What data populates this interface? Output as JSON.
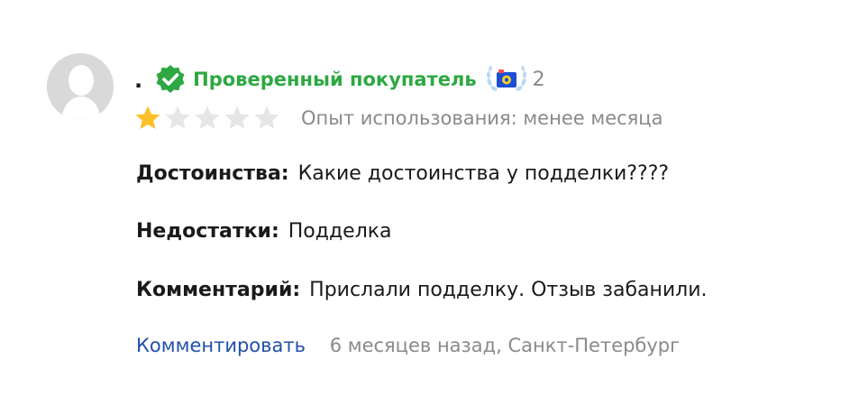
{
  "review": {
    "author_name": ".",
    "verified_label": "Проверенный покупатель",
    "award_count": "2",
    "rating": 1,
    "rating_max": 5,
    "usage_text": "Опыт использования: менее месяца",
    "pros_label": "Достоинства:",
    "pros_text": "Какие достоинства у подделки????",
    "cons_label": "Недостатки:",
    "cons_text": "Подделка",
    "comment_label": "Комментарий:",
    "comment_text": "Прислали подделку. Отзыв забанили.",
    "reply_link": "Комментировать",
    "meta": "6 месяцев назад, Санкт-Петербург"
  },
  "colors": {
    "verified_green": "#2ea842",
    "star_filled": "#fcc02b",
    "star_empty": "#e6e6e6",
    "link_blue": "#2050a8",
    "muted_gray": "#8a8a8a",
    "award_laurel": "#b9d9f2",
    "award_camera": "#1c4fd6"
  },
  "icons": {
    "avatar": "user-silhouette-icon",
    "verified": "check-badge-icon",
    "award": "camera-laurel-icon",
    "star": "star-icon"
  }
}
